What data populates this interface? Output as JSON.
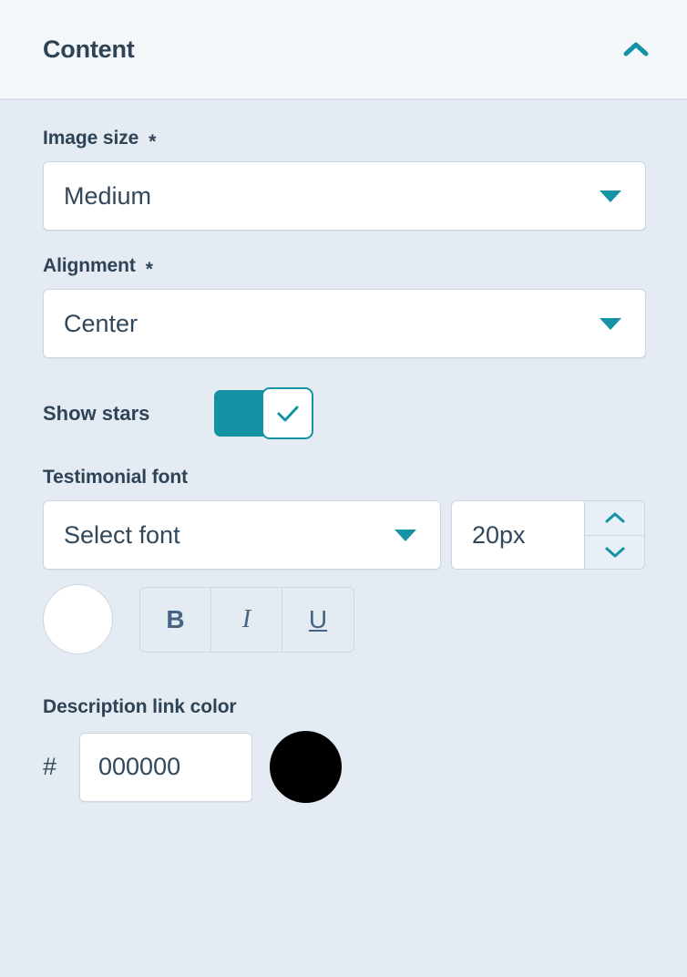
{
  "header": {
    "title": "Content",
    "collapse_icon": "chevron-up-icon"
  },
  "fields": {
    "image_size": {
      "label": "Image size",
      "required_marker": "*",
      "value": "Medium",
      "caret_icon": "caret-down-icon"
    },
    "alignment": {
      "label": "Alignment",
      "required_marker": "*",
      "value": "Center",
      "caret_icon": "caret-down-icon"
    },
    "show_stars": {
      "label": "Show stars",
      "checked": true,
      "check_icon": "check-icon"
    },
    "testimonial_font": {
      "label": "Testimonial font",
      "font_value": "Select font",
      "font_placeholder": "Select font",
      "caret_icon": "caret-down-icon",
      "size_value": "20px",
      "increment_icon": "chevron-up-icon",
      "decrement_icon": "chevron-down-icon",
      "color_swatch": "#ffffff",
      "bold_label": "B",
      "italic_label": "I",
      "underline_label": "U"
    },
    "description_link_color": {
      "label": "Description link color",
      "hash_prefix": "#",
      "hex_value": "000000",
      "hex_placeholder": "000000",
      "swatch_color": "#000000"
    }
  },
  "colors": {
    "accent": "#1593a4",
    "panel_background": "#e4ebf3",
    "header_background": "#f3f7fa",
    "text": "#33475b",
    "border": "#cbd6e2"
  }
}
